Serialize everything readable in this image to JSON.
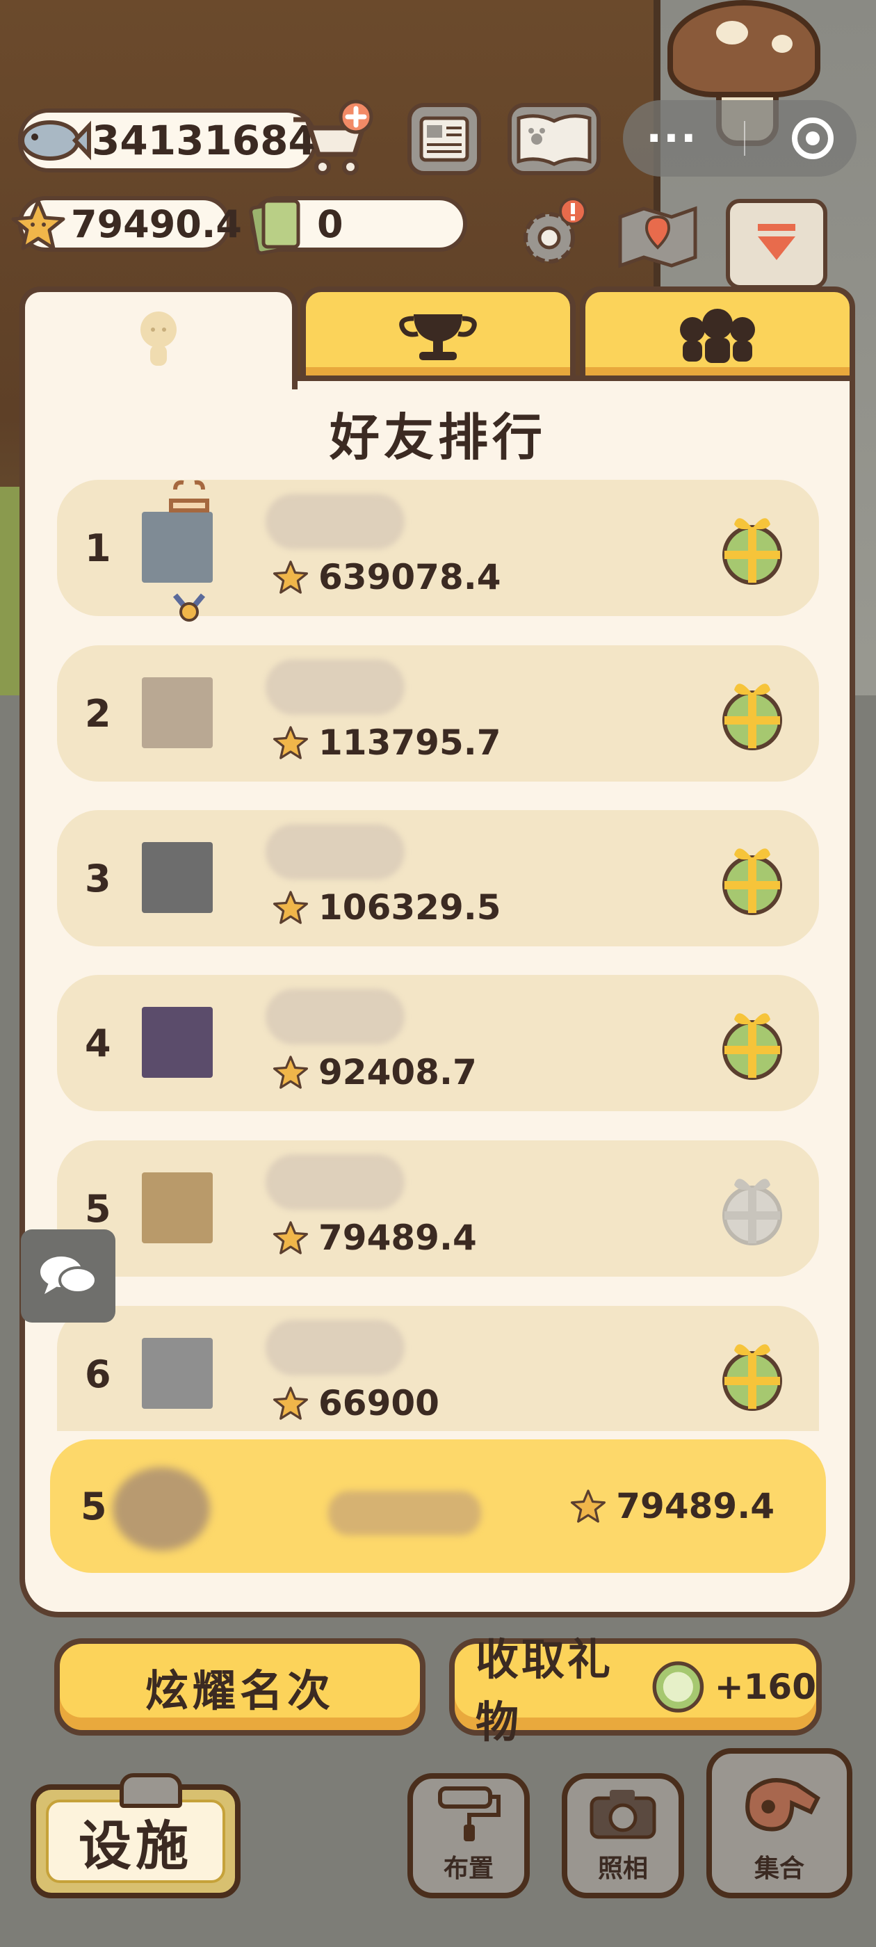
{
  "hud": {
    "fish_coins": "34131684",
    "stars": "79490.4",
    "tickets": "0"
  },
  "capsule": {
    "more": "···"
  },
  "panel": {
    "title": "好友排行",
    "tabs": [
      {
        "icon": "friend-head-icon"
      },
      {
        "icon": "trophy-icon"
      },
      {
        "icon": "group-icon"
      }
    ]
  },
  "ranking": [
    {
      "rank": "1",
      "score": "639078.4",
      "gift": "available"
    },
    {
      "rank": "2",
      "score": "113795.7",
      "gift": "available"
    },
    {
      "rank": "3",
      "score": "106329.5",
      "gift": "available"
    },
    {
      "rank": "4",
      "score": "92408.7",
      "gift": "available"
    },
    {
      "rank": "5",
      "score": "79489.4",
      "gift": "used"
    },
    {
      "rank": "6",
      "score": "66900",
      "gift": "available"
    }
  ],
  "self": {
    "rank": "5",
    "score": "79489.4"
  },
  "buttons": {
    "show_rank": "炫耀名次",
    "collect_gift": "收取礼物",
    "gift_count": "+160",
    "facility": "设施",
    "layout": "布置",
    "photo": "照相",
    "gather": "集合"
  },
  "colors": {
    "accent_yellow": "#fbd35a",
    "panel_bg": "#fcf4e8",
    "row_bg": "#f3e5c6",
    "outline": "#5b3f2f",
    "text": "#3b2a22"
  }
}
